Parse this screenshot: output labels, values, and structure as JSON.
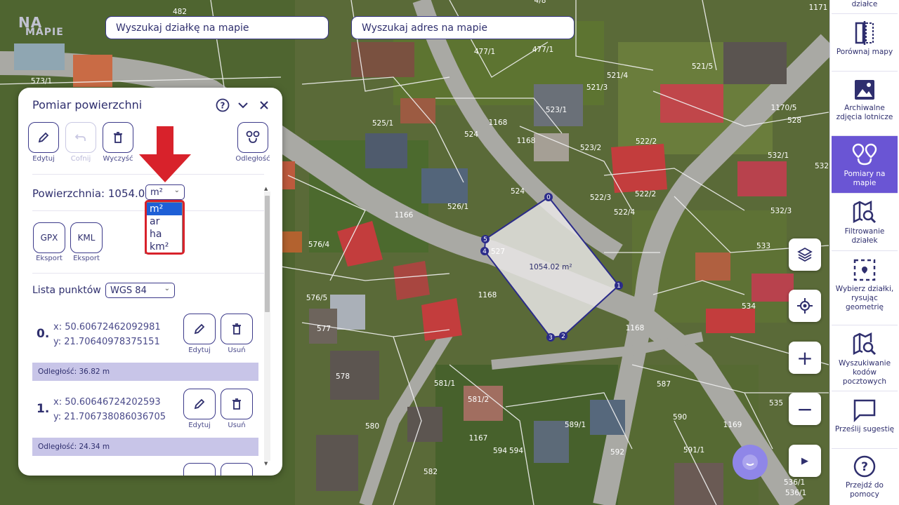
{
  "brand": {
    "logo_line1": "NA",
    "logo_line2": "MAPIE"
  },
  "search": {
    "parcel_placeholder": "Wyszukaj działkę na mapie",
    "address_placeholder": "Wyszukaj adres na mapie"
  },
  "sidebar": {
    "items": [
      {
        "label": "działce",
        "icon": "document-icon",
        "active": false
      },
      {
        "label": "Porównaj mapy",
        "icon": "compare-icon",
        "active": false
      },
      {
        "label": "Archiwalne zdjęcia lotnicze",
        "icon": "image-icon",
        "active": false
      },
      {
        "label": "Pomiary na mapie",
        "icon": "measure-pins-icon",
        "active": true
      },
      {
        "label": "Filtrowanie działek",
        "icon": "map-search-icon",
        "active": false
      },
      {
        "label": "Wybierz działki, rysując geometrię",
        "icon": "select-area-icon",
        "active": false
      },
      {
        "label": "Wyszukiwanie kodów pocztowych",
        "icon": "map-search-icon",
        "active": false
      },
      {
        "label": "Prześlij sugestię",
        "icon": "chat-icon",
        "active": false
      },
      {
        "label": "Przejdź do pomocy",
        "icon": "help-icon",
        "active": false
      }
    ],
    "accent": "#6a55d4"
  },
  "map": {
    "measured_area_label": "1054.02 m²",
    "vertices": [
      "0",
      "1",
      "2",
      "3",
      "4",
      "5"
    ],
    "parcel_labels": [
      "482",
      "4/8",
      "1171",
      "573/1",
      "477/1",
      "477/1",
      "521/4",
      "521/3",
      "521/5",
      "523/1",
      "1170/5",
      "525/1",
      "1168",
      "524",
      "522/2",
      "528",
      "1168",
      "523/2",
      "532/1",
      "532",
      "524",
      "522/3",
      "522/2",
      "526/1",
      "522/4",
      "532/3",
      "1166",
      "527",
      "533",
      "576/4",
      "576/5",
      "1168",
      "534",
      "577",
      "1168",
      "578",
      "581/1",
      "587",
      "581/2",
      "589/1",
      "590",
      "535",
      "580",
      "1167",
      "594",
      "594",
      "592",
      "591/1",
      "1169",
      "582",
      "536/1",
      "536/1"
    ],
    "controls": [
      "layers-icon",
      "locate-icon",
      "zoom-in-icon",
      "zoom-out-icon",
      "expand-icon"
    ]
  },
  "panel": {
    "title": "Pomiar powierzchni",
    "tools": {
      "edit": "Edytuj",
      "undo": "Cofnij",
      "clear": "Wyczyść",
      "distance": "Odległość"
    },
    "area_label": "Powierzchnia:",
    "area_value": "1054.02",
    "unit_selected": "m²",
    "unit_options": [
      "m²",
      "ar",
      "ha",
      "km²"
    ],
    "export": [
      {
        "format": "GPX",
        "label": "Eksport"
      },
      {
        "format": "KML",
        "label": "Eksport"
      }
    ],
    "points_label": "Lista punktów",
    "crs_selected": "WGS 84",
    "points": [
      {
        "num": "0.",
        "x": "x: 50.60672462092981",
        "y": "y: 21.70640978375151",
        "edit": "Edytuj",
        "delete": "Usuń",
        "distance": "Odległość: 36.82 m"
      },
      {
        "num": "1.",
        "x": "x: 50.60646724202593",
        "y": "y: 21.706738086036705",
        "edit": "Edytuj",
        "delete": "Usuń",
        "distance": "Odległość: 24.34 m"
      }
    ]
  },
  "annotation": {
    "arrow_color": "#d8222b"
  }
}
